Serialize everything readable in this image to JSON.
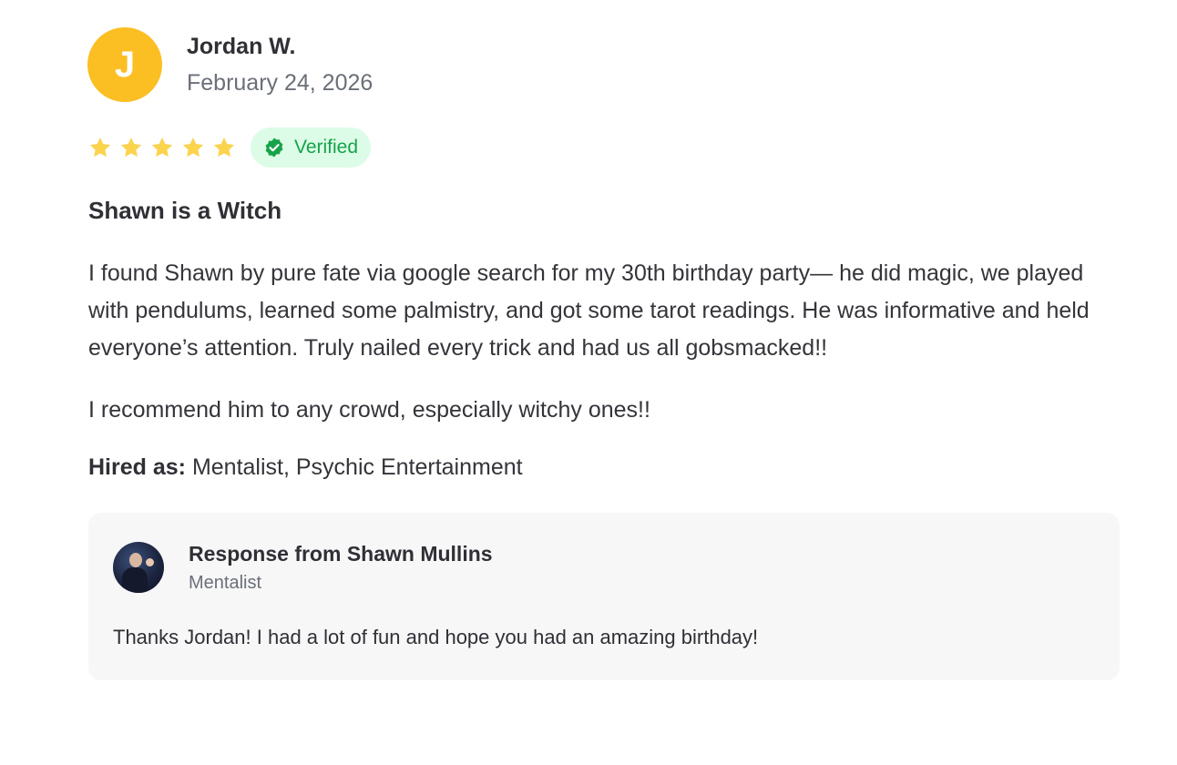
{
  "review": {
    "avatar_initial": "J",
    "author_name": "Jordan W.",
    "date": "February 24, 2026",
    "rating": 5,
    "rating_max": 5,
    "star_color": "#fbbf24",
    "verified_label": "Verified",
    "title": "Shawn is a Witch",
    "body_paragraphs": [
      "I found Shawn by pure fate via google search for my 30th birthday party— he did magic, we played with pendulums, learned some palmistry, and got some tarot readings. He was informative and held everyone’s attention. Truly nailed every trick and had us all gobsmacked!!",
      "I recommend him to any crowd, especially witchy ones!!"
    ],
    "hired_as_label": "Hired as:",
    "hired_as_value": "Mentalist, Psychic Entertainment"
  },
  "response": {
    "title": "Response from Shawn Mullins",
    "role": "Mentalist",
    "text": "Thanks Jordan! I had a lot of fun and hope you had an amazing birthday!"
  }
}
